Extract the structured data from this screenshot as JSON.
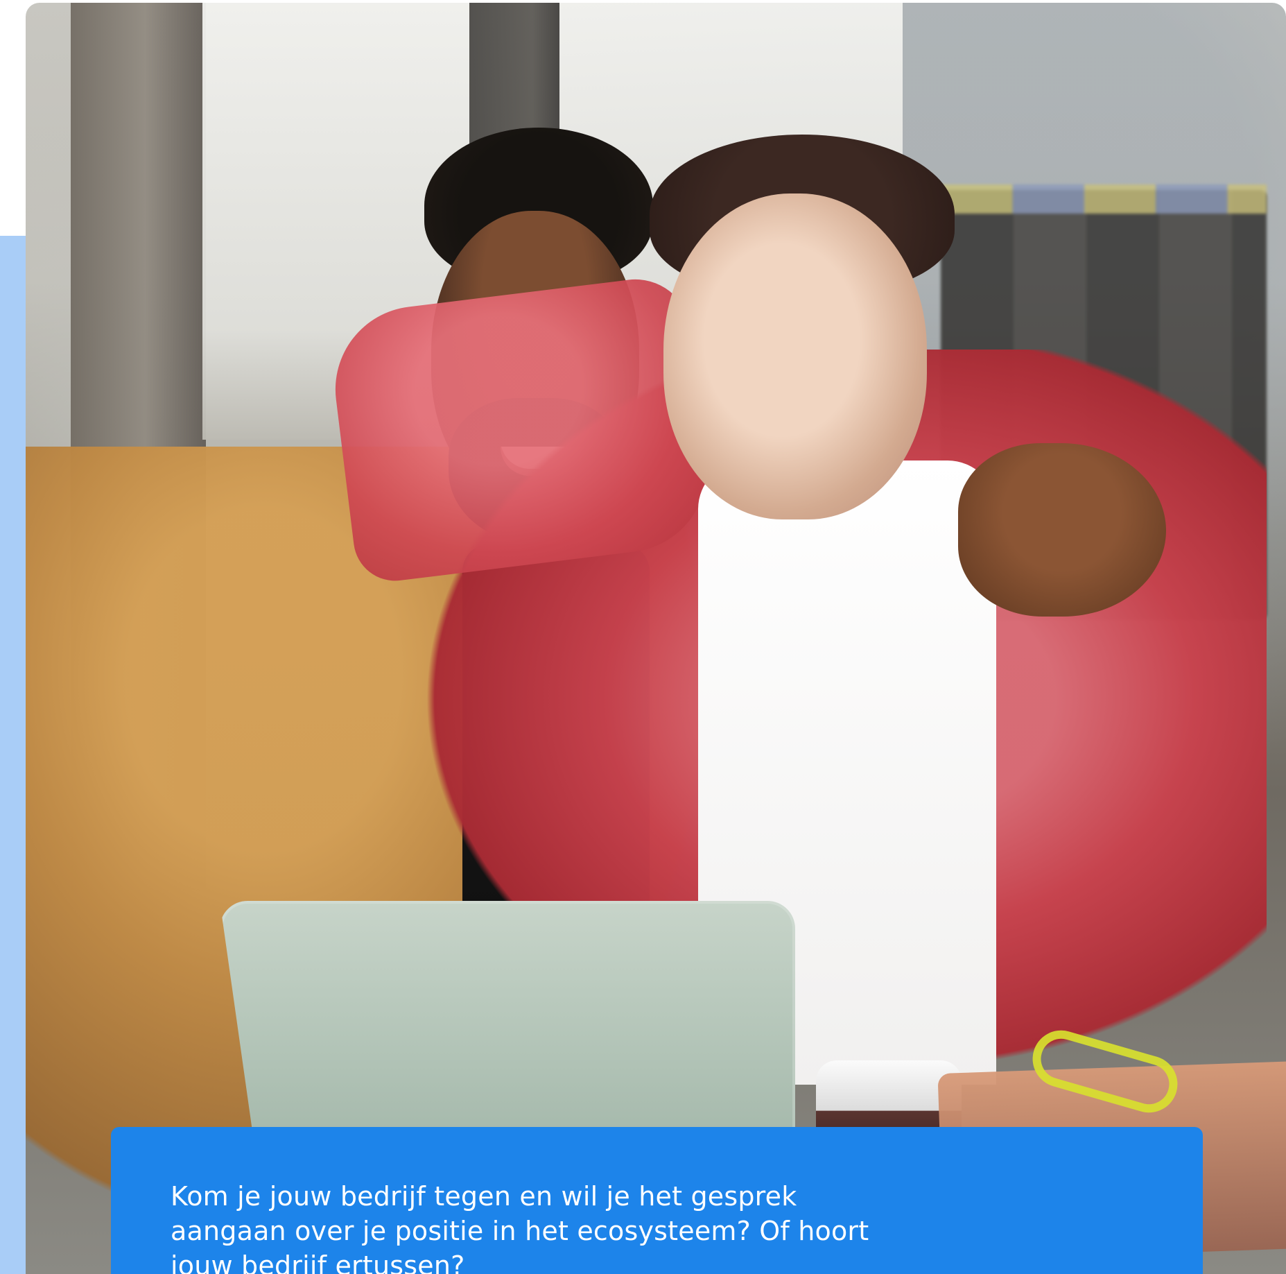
{
  "hero": {
    "image_icon": "hero-photo"
  },
  "card": {
    "text": "Kom je jouw bedrijf tegen en wil je het gesprek aangaan over je positie in het ecosysteem? Of hoort jouw bedrijf ertussen?"
  },
  "colors": {
    "accent": "#a9cdf7",
    "card": "#1d84ea",
    "text": "#ffffff"
  }
}
